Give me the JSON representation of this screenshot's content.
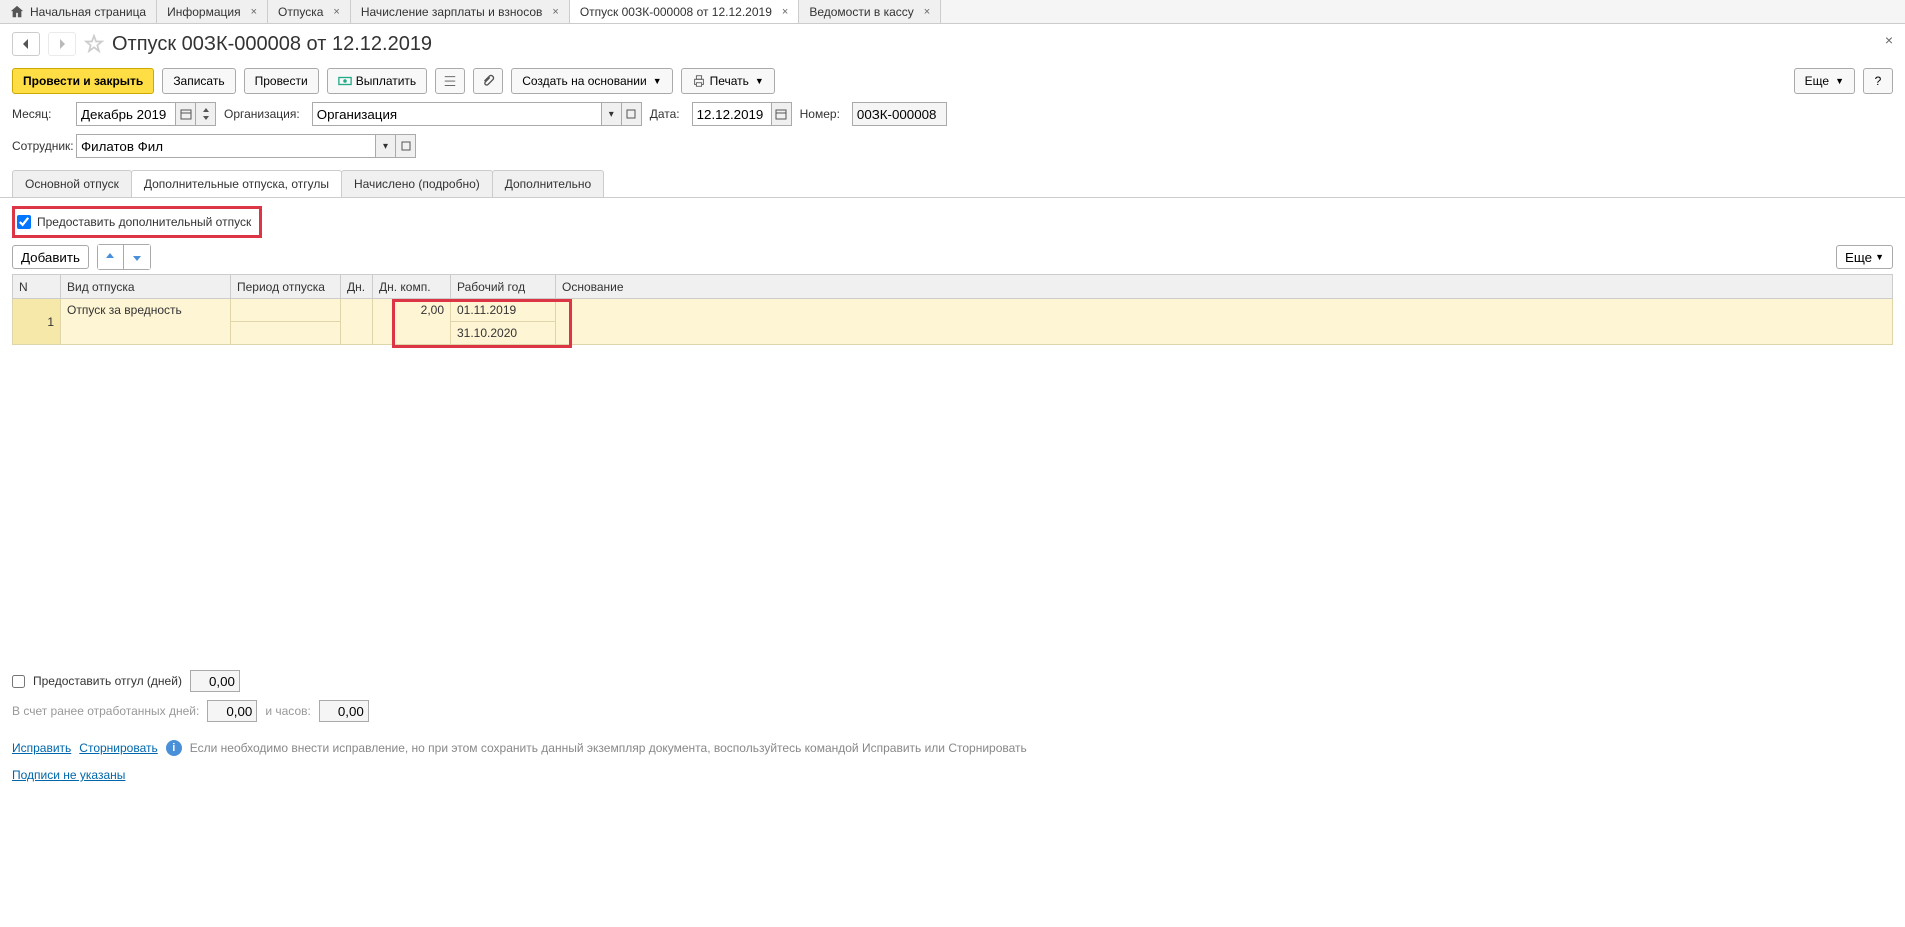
{
  "tabs": [
    {
      "label": "Начальная страница",
      "closable": false,
      "home": true
    },
    {
      "label": "Информация",
      "closable": true
    },
    {
      "label": "Отпуска",
      "closable": true
    },
    {
      "label": "Начисление зарплаты и взносов",
      "closable": true
    },
    {
      "label": "Отпуск 00ЗК-000008 от 12.12.2019",
      "closable": true,
      "active": true
    },
    {
      "label": "Ведомости в кассу",
      "closable": true
    }
  ],
  "page_title": "Отпуск 00ЗК-000008 от 12.12.2019",
  "toolbar": {
    "post_close": "Провести и закрыть",
    "save": "Записать",
    "post": "Провести",
    "pay": "Выплатить",
    "create_based": "Создать на основании",
    "print": "Печать",
    "more": "Еще"
  },
  "form": {
    "month_label": "Месяц:",
    "month_value": "Декабрь 2019",
    "org_label": "Организация:",
    "org_value": "Организация",
    "date_label": "Дата:",
    "date_value": "12.12.2019",
    "number_label": "Номер:",
    "number_value": "00ЗК-000008",
    "employee_label": "Сотрудник:",
    "employee_value": "Филатов Фил"
  },
  "doc_tabs": {
    "main": "Основной отпуск",
    "additional": "Дополнительные отпуска, отгулы",
    "accrued": "Начислено (подробно)",
    "extra": "Дополнительно"
  },
  "additional_vacation_checkbox": "Предоставить дополнительный отпуск",
  "table_toolbar": {
    "add": "Добавить",
    "more": "Еще"
  },
  "table": {
    "headers": {
      "n": "N",
      "type": "Вид отпуска",
      "period": "Период отпуска",
      "days": "Дн.",
      "days_comp": "Дн. комп.",
      "work_year": "Рабочий год",
      "basis": "Основание"
    },
    "rows": [
      {
        "n": "1",
        "type": "Отпуск за вредность",
        "period": "",
        "days": "",
        "days_comp": "2,00",
        "work_year_from": "01.11.2019",
        "work_year_to": "31.10.2020",
        "basis": ""
      }
    ]
  },
  "footer": {
    "compensatory_checkbox": "Предоставить отгул (дней)",
    "compensatory_value": "0,00",
    "worked_days_label": "В счет ранее отработанных дней:",
    "worked_days_value": "0,00",
    "hours_label": "и часов:",
    "hours_value": "0,00",
    "correct_link": "Исправить",
    "reverse_link": "Сторнировать",
    "info_text": "Если необходимо внести исправление, но при этом сохранить данный экземпляр документа, воспользуйтесь командой Исправить или Сторнировать",
    "signatures_link": "Подписи не указаны"
  }
}
